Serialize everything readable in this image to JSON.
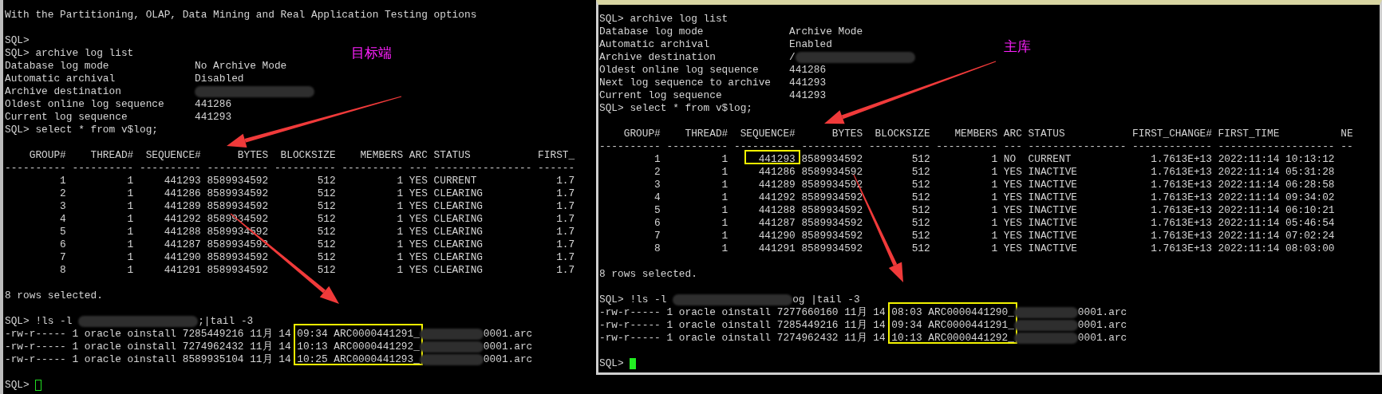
{
  "terminals": [
    {
      "cursor_filled": false,
      "annotation": "目标端",
      "blocks": [
        [
          {
            "text": "With the Partitioning, OLAP, Data Mining and Real Application Testing options"
          }
        ],
        [
          {
            "text": "SQL>"
          },
          {
            "text": "SQL> archive log list"
          },
          {
            "text": "Database log mode              No Archive Mode"
          },
          {
            "text": "Automatic archival             Disabled"
          },
          {
            "text": "Archive destination            ",
            "redacted": true
          },
          {
            "text": "Oldest online log sequence     441286"
          },
          {
            "text": "Current log sequence           441293"
          },
          {
            "text": "SQL> select * from v$log;"
          }
        ],
        [
          {
            "text": "    GROUP#    THREAD#  SEQUENCE#      BYTES  BLOCKSIZE    MEMBERS ARC STATUS           FIRST_"
          },
          {
            "text": "---------- ---------- ---------- ---------- ---------- ---------- --- ---------------- ------"
          },
          {
            "text": "         1          1     441293 8589934592        512          1 YES CURRENT             1.7"
          },
          {
            "text": "         2          1     441286 8589934592        512          1 YES CLEARING            1.7"
          },
          {
            "text": "         3          1     441289 8589934592        512          1 YES CLEARING            1.7"
          },
          {
            "text": "         4          1     441292 8589934592        512          1 YES CLEARING            1.7"
          },
          {
            "text": "         5          1     441288 8589934592        512          1 YES CLEARING            1.7"
          },
          {
            "text": "         6          1     441287 8589934592        512          1 YES CLEARING            1.7"
          },
          {
            "text": "         7          1     441290 8589934592        512          1 YES CLEARING            1.7"
          },
          {
            "text": "         8          1     441291 8589934592        512          1 YES CLEARING            1.7"
          }
        ],
        [
          {
            "text": "8 rows selected."
          }
        ],
        [
          {
            "text": "SQL> !ls -l ",
            "redacted": true,
            "after": ";|tail -3"
          },
          {
            "text": "-rw-r----- 1 oracle oinstall 7285449216 11月 14 ",
            "boxed": "09:34 ARC0000441291_",
            "redacted": true,
            "after": "0001.arc"
          },
          {
            "text": "-rw-r----- 1 oracle oinstall 7274962432 11月 14 ",
            "boxed": "10:13 ARC0000441292_",
            "redacted": true,
            "after": "0001.arc"
          },
          {
            "text": "-rw-r----- 1 oracle oinstall 8589935104 11月 14 ",
            "boxed": "10:25 ARC0000441293_",
            "redacted": true,
            "after": "0001.arc"
          }
        ],
        [
          {
            "text": "SQL> "
          }
        ]
      ]
    },
    {
      "cursor_filled": true,
      "annotation": "主库",
      "blocks": [
        [
          {
            "text": "SQL> archive log list"
          },
          {
            "text": "Database log mode              Archive Mode"
          },
          {
            "text": "Automatic archival             Enabled"
          },
          {
            "text": "Archive destination            /",
            "redacted": true
          },
          {
            "text": "Oldest online log sequence     441286"
          },
          {
            "text": "Next log sequence to archive   441293"
          },
          {
            "text": "Current log sequence           441293"
          },
          {
            "text": "SQL> select * from v$log;"
          }
        ],
        [
          {
            "text": "    GROUP#    THREAD#  SEQUENCE#      BYTES  BLOCKSIZE    MEMBERS ARC STATUS           FIRST_CHANGE# FIRST_TIME          NE"
          },
          {
            "text": "---------- ---------- ---------- ---------- ---------- ---------- --- ---------------- ------------- ------------------- --"
          },
          {
            "text": "         1          1     ",
            "boxed": "441293",
            "after": " 8589934592        512          1 NO  CURRENT             1.7613E+13 2022:11:14 10:13:12"
          },
          {
            "text": "         2          1     441286 8589934592        512          1 YES INACTIVE            1.7613E+13 2022:11:14 05:31:28"
          },
          {
            "text": "         3          1     441289 8589934592        512          1 YES INACTIVE            1.7613E+13 2022:11:14 06:28:58"
          },
          {
            "text": "         4          1     441292 8589934592        512          1 YES INACTIVE            1.7613E+13 2022:11:14 09:34:02"
          },
          {
            "text": "         5          1     441288 8589934592        512          1 YES INACTIVE            1.7613E+13 2022:11:14 06:10:21"
          },
          {
            "text": "         6          1     441287 8589934592        512          1 YES INACTIVE            1.7613E+13 2022:11:14 05:46:54"
          },
          {
            "text": "         7          1     441290 8589934592        512          1 YES INACTIVE            1.7613E+13 2022:11:14 07:02:24"
          },
          {
            "text": "         8          1     441291 8589934592        512          1 YES INACTIVE            1.7613E+13 2022:11:14 08:03:00"
          }
        ],
        [
          {
            "text": "8 rows selected."
          }
        ],
        [
          {
            "text": "SQL> !ls -l ",
            "redacted": true,
            "after": "og |tail -3"
          },
          {
            "text": "-rw-r----- 1 oracle oinstall 7277660160 11月 14 ",
            "boxed": "08:03 ARC0000441290_",
            "redacted": true,
            "after": "0001.arc"
          },
          {
            "text": "-rw-r----- 1 oracle oinstall 7285449216 11月 14 ",
            "boxed": "09:34 ARC0000441291_",
            "redacted": true,
            "after": "0001.arc"
          },
          {
            "text": "-rw-r----- 1 oracle oinstall 7274962432 11月 14 ",
            "boxed": "10:13 ARC0000441292_",
            "redacted": true,
            "after": "0001.arc"
          }
        ],
        [
          {
            "text": "SQL> "
          }
        ]
      ]
    }
  ]
}
